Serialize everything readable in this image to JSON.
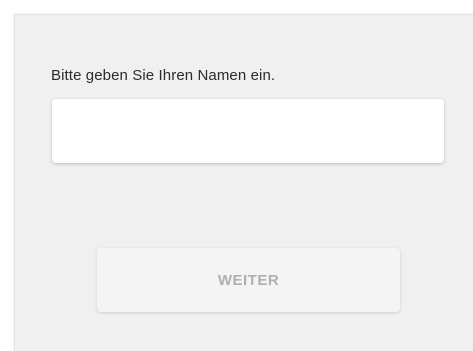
{
  "form": {
    "prompt_label": "Bitte geben Sie Ihren Namen ein.",
    "name_input": {
      "value": "",
      "placeholder": ""
    },
    "next_button_label": "WEITER",
    "next_button_state": "disabled"
  }
}
